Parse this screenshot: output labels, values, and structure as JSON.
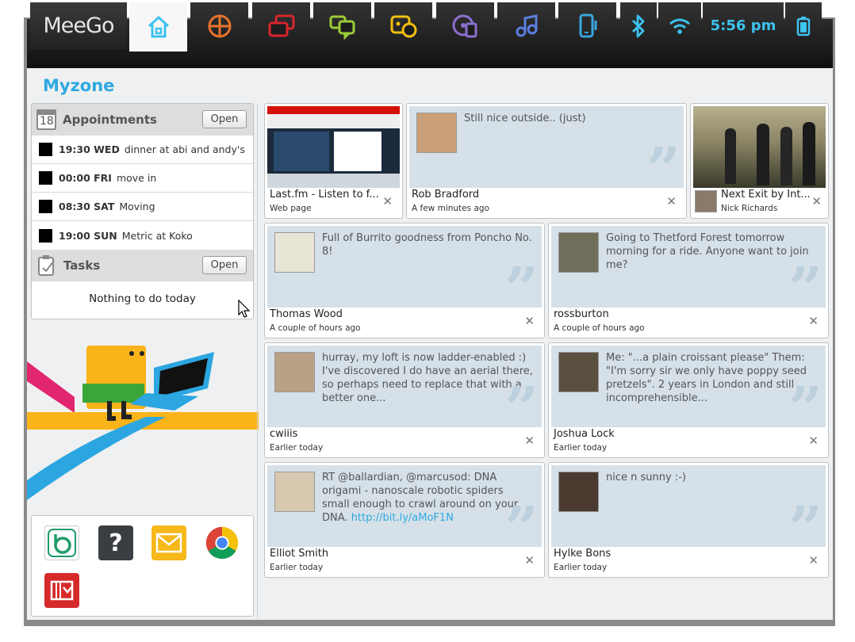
{
  "topbar": {
    "logo": "MeeGo",
    "clock": "5:56 pm",
    "icons": [
      "home-icon",
      "apps-grid-icon",
      "windows-icon",
      "chat-icon",
      "people-icon",
      "media-icon",
      "music-icon",
      "devices-icon",
      "bluetooth-icon",
      "wifi-icon",
      "battery-icon"
    ],
    "colors": {
      "home": "#3cc3f0",
      "apps": "#e8732a",
      "windows": "#d8262c",
      "chat": "#9ccc36",
      "people": "#f3c010",
      "media": "#8c6fcf",
      "music": "#5b7fe0",
      "devices": "#3aa6e0"
    }
  },
  "panel": {
    "title": "Myzone"
  },
  "appointments": {
    "title": "Appointments",
    "calendar_day": "18",
    "open_label": "Open",
    "items": [
      {
        "time": "19:30 WED",
        "text": "dinner at abi and andy's"
      },
      {
        "time": "00:00 FRI",
        "text": "move in"
      },
      {
        "time": "08:30 SAT",
        "text": "Moving"
      },
      {
        "time": "19:00 SUN",
        "text": "Metric at Koko"
      }
    ]
  },
  "tasks": {
    "title": "Tasks",
    "open_label": "Open",
    "empty": "Nothing to do today"
  },
  "apps": [
    "banshee-icon",
    "help-icon",
    "email-icon",
    "chrome-icon",
    "photos-icon"
  ],
  "top_tiles": [
    {
      "name": "Last.fm - Listen to f...",
      "sub": "Web page"
    },
    {
      "msg": "Still nice outside.. (just)",
      "name": "Rob Bradford",
      "sub": "A few minutes ago"
    },
    {
      "name": "Next Exit by Int...",
      "sub": "Nick Richards"
    }
  ],
  "feed": [
    {
      "msg": "Full of Burrito goodness from Poncho No. 8!",
      "name": "Thomas Wood",
      "time": "A couple of hours ago"
    },
    {
      "msg": "Going to Thetford Forest tomorrow morning for a ride. Anyone want to join me?",
      "name": "rossburton",
      "time": "A couple of hours ago"
    },
    {
      "msg": "hurray, my loft is now ladder-enabled :) I've discovered I do have an aerial there, so perhaps need to replace that with a better one...",
      "name": "cwiiis",
      "time": "Earlier today"
    },
    {
      "msg": "Me: \"...a plain croissant please\" Them: \"I'm sorry sir we only have poppy seed pretzels\". 2 years in London and still incomprehensible...",
      "name": "Joshua Lock",
      "time": "Earlier today"
    },
    {
      "msg": "RT @ballardian, @marcusod: DNA origami - nanoscale robotic spiders small enough to crawl around on your DNA.",
      "link": "http://bit.ly/aMoF1N",
      "name": "Elliot Smith",
      "time": "Earlier today"
    },
    {
      "msg": "nice n sunny :-)",
      "name": "Hylke Bons",
      "time": "Earlier today"
    }
  ]
}
